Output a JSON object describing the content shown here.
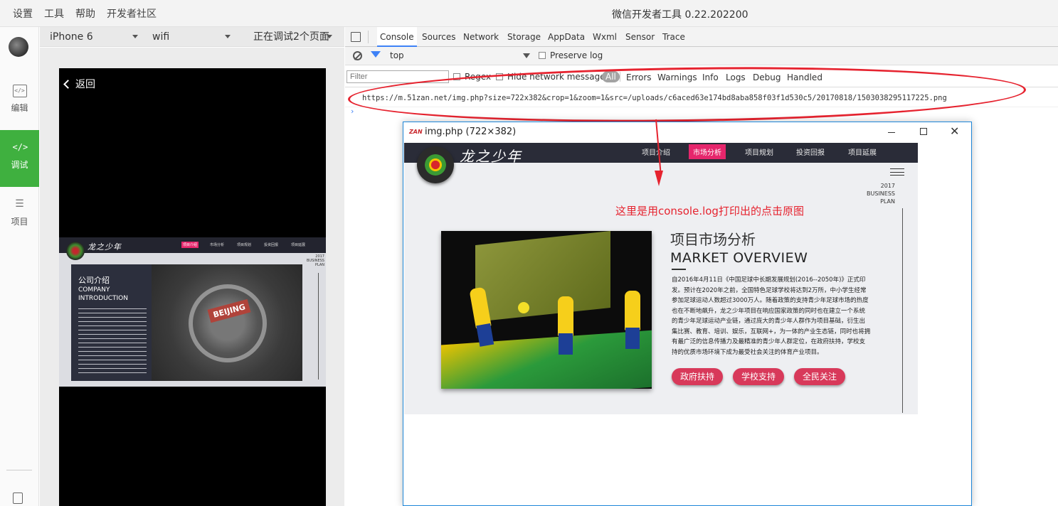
{
  "menu": {
    "settings": "设置",
    "tools": "工具",
    "help": "帮助",
    "community": "开发者社区"
  },
  "app_title": "微信开发者工具 0.22.202200",
  "rail": [
    {
      "label": "编辑",
      "icon": "code-icon"
    },
    {
      "label": "调试",
      "icon": "debug-icon"
    },
    {
      "label": "项目",
      "icon": "menu-icon"
    }
  ],
  "simulator": {
    "device": "iPhone 6",
    "network": "wifi",
    "pages": "正在调试2个页面"
  },
  "phone": {
    "back": "返回",
    "brand": "龙之少年",
    "menu": [
      "项目介绍",
      "市场分析",
      "项目规划",
      "投资回报",
      "项目延展"
    ],
    "title_cn": "公司介绍",
    "title_en_1": "COMPANY",
    "title_en_2": "INTRODUCTION",
    "map_label": "BEIJING",
    "year": "2017",
    "plan_1": "BUSINESS",
    "plan_2": "PLAN"
  },
  "devtools": {
    "tabs": [
      "Console",
      "Sources",
      "Network",
      "Storage",
      "AppData",
      "Wxml",
      "Sensor",
      "Trace"
    ],
    "context": "top",
    "preserve_log": "Preserve log",
    "filter_placeholder": "Filter",
    "regex": "Regex",
    "hide_network": "Hide network messages",
    "levels": [
      "All",
      "Errors",
      "Warnings",
      "Info",
      "Logs",
      "Debug",
      "Handled"
    ],
    "log_url": "https://m.51zan.net/img.php?size=722x382&crop=1&zoom=1&src=/uploads/c6aced63e174bd8aba858f03f1d530c5/20170818/1503038295117225.png"
  },
  "popup": {
    "favicon": "ZAN",
    "title": "img.php (722×382)",
    "brand": "龙之少年",
    "menu": [
      "项目介绍",
      "市场分析",
      "项目规划",
      "投资回报",
      "项目延展"
    ],
    "year": "2017",
    "plan_1": "BUSINESS",
    "plan_2": "PLAN",
    "heading_cn": "项目市场分析",
    "heading_en": "MARKET OVERVIEW",
    "paragraph": "自2016年4月11日《中国足球中长期发展规划(2016--2050年)》正式印发。预计在2020年之前，全国特色足球学校将达到2万所，中小学生经常参加足球运动人数超过3000万人。随着政策的支持青少年足球市场的热度也在不断地飙升，龙之少年项目在响应国家政策的同时也在建立一个系统的青少年足球运动产业链，通过庞大的青少年人群作为项目基础，衍生出集比赛、教育、培训、娱乐，互联网+，为一体的产业生态链，同时也将拥有最广泛的信息传播力及最精准的青少年人群定位，在政府扶持，学校支持的优质市场环境下成为最受社会关注的体育产业项目。",
    "buttons": [
      "政府扶持",
      "学校支持",
      "全民关注"
    ]
  },
  "annotation": "这里是用console.log打印出的点击原图",
  "colors": {
    "accent_green": "#3fb03f",
    "annotation_red": "#e6232f",
    "tab_blue": "#3e82f7",
    "brand_pink": "#e6266c"
  }
}
